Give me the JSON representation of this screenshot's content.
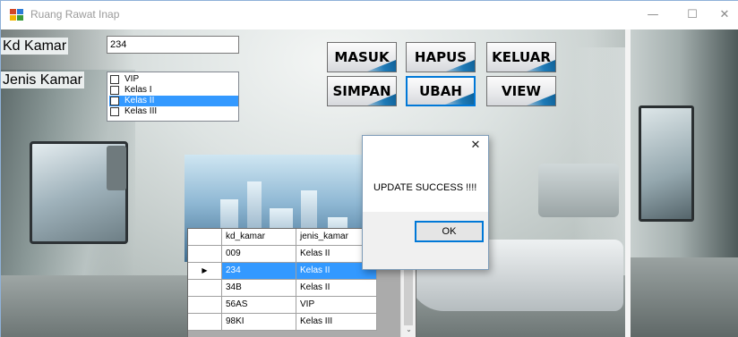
{
  "window": {
    "title": "Ruang Rawat Inap",
    "controls": {
      "minimize": "—",
      "maximize": "☐",
      "close": "✕"
    }
  },
  "form": {
    "kd_kamar_label": "Kd Kamar",
    "kd_kamar_value": "234",
    "jenis_kamar_label": "Jenis Kamar",
    "jenis_kamar_options": [
      {
        "label": "VIP",
        "checked": false,
        "selected": false
      },
      {
        "label": "Kelas I",
        "checked": false,
        "selected": false
      },
      {
        "label": "Kelas II",
        "checked": false,
        "selected": true
      },
      {
        "label": "Kelas III",
        "checked": false,
        "selected": false
      }
    ]
  },
  "buttons": {
    "masuk": "MASUK",
    "hapus": "HAPUS",
    "keluar": "KELUAR",
    "simpan": "SIMPAN",
    "ubah": "UBAH",
    "view": "VIEW"
  },
  "dialog": {
    "close": "✕",
    "message": "UPDATE SUCCESS !!!!",
    "ok": "OK"
  },
  "grid": {
    "headers": [
      "kd_kamar",
      "jenis_kamar"
    ],
    "current_row_marker": "▶",
    "rows": [
      {
        "kd_kamar": "009",
        "jenis_kamar": "Kelas II",
        "selected": false
      },
      {
        "kd_kamar": "234",
        "jenis_kamar": "Kelas II",
        "selected": true
      },
      {
        "kd_kamar": "34B",
        "jenis_kamar": "Kelas II",
        "selected": false
      },
      {
        "kd_kamar": "56AS",
        "jenis_kamar": "VIP",
        "selected": false
      },
      {
        "kd_kamar": "98KI",
        "jenis_kamar": "Kelas III",
        "selected": false
      }
    ],
    "scroll_down": "⌄"
  },
  "colors": {
    "selection": "#3399ff",
    "focus_border": "#0078d7",
    "button_accent": "#1e7bb8"
  }
}
